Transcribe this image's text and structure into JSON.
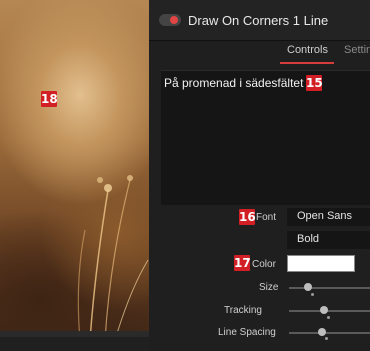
{
  "preview": {
    "badge": "18"
  },
  "inspector": {
    "title": "Draw On Corners 1 Line",
    "tabs": [
      "Controls",
      "Settings"
    ],
    "text_badge": "15",
    "text_value": "På promenad i sädesfältet",
    "font": {
      "badge": "16",
      "label": "Font",
      "family": "Open Sans",
      "style": "Bold"
    },
    "color": {
      "badge": "17",
      "label": "Color",
      "value": "#ffffff"
    },
    "size": {
      "label": "Size",
      "level": 0.15
    },
    "tracking": {
      "label": "Tracking",
      "level": 0.22
    },
    "line_spacing": {
      "label": "Line Spacing",
      "level": 0.18
    }
  },
  "colors": {
    "accent": "#d21f26",
    "tab_underline": "#d63c3c"
  }
}
